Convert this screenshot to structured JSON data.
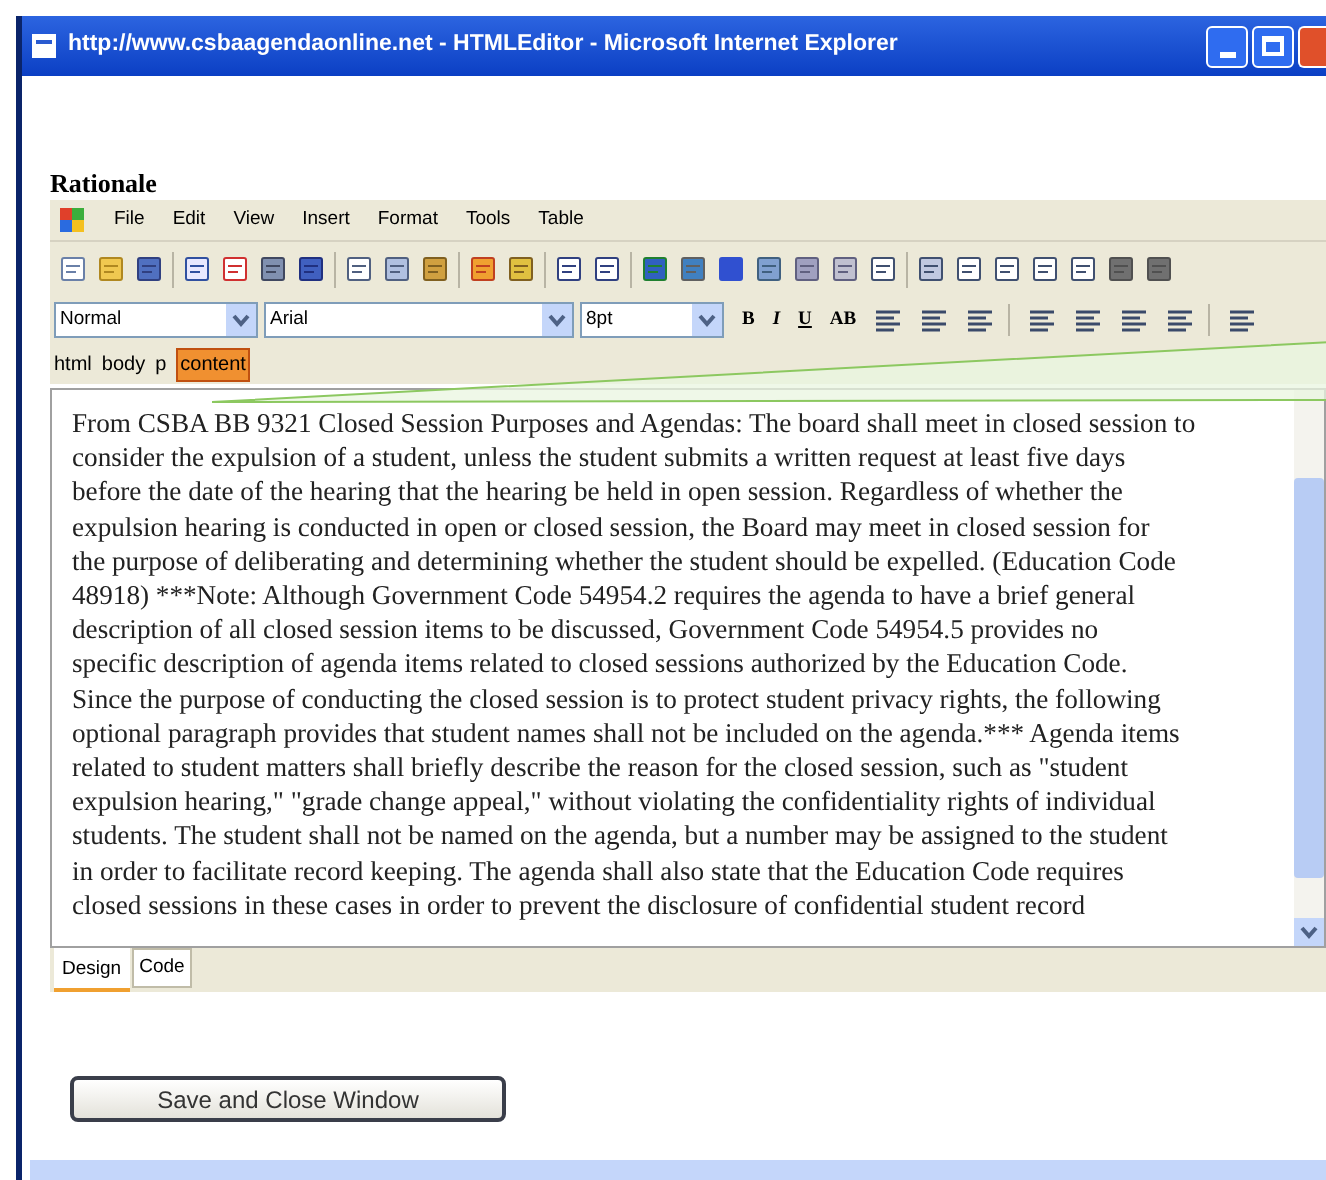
{
  "window": {
    "title": "http://www.csbaagendaonline.net - HTMLEditor - Microsoft Internet Explorer"
  },
  "heading": "Rationale",
  "menu": [
    "File",
    "Edit",
    "View",
    "Insert",
    "Format",
    "Tools",
    "Table"
  ],
  "format_bar": {
    "style": "Normal",
    "font": "Arial",
    "size": "8pt",
    "buttons": [
      "B",
      "I",
      "U",
      "AB"
    ]
  },
  "tag_path": [
    {
      "label": "html",
      "selected": false
    },
    {
      "label": "body",
      "selected": false
    },
    {
      "label": "p",
      "selected": false
    },
    {
      "label": "content",
      "selected": true
    }
  ],
  "editor": {
    "text": "From CSBA BB 9321 Closed Session Purposes and Agendas: The board shall meet in closed session to\nconsider the expulsion of a student, unless the student submits a written request at least five days\nbefore the date of the hearing that the hearing be held in open session. Regardless of whether the\nexpulsion hearing is conducted in open or closed session, the Board may meet in closed session for\nthe purpose of deliberating and determining whether the student should be expelled. (Education Code\n48918) ***Note: Although Government Code 54954.2 requires the agenda to have a brief general\ndescription of all closed session items to be discussed, Government Code 54954.5 provides no\nspecific description of agenda items related to closed sessions authorized by the Education Code.\nSince the purpose of conducting the closed session is to protect student privacy rights, the following\noptional paragraph provides that student names shall not be included on the agenda.*** Agenda items\nrelated to student matters shall briefly describe the reason for the closed session, such as \"student\nexpulsion hearing,\" \"grade change appeal,\" without violating the confidentiality rights of individual\nstudents. The student shall not be named on the agenda, but a number may be assigned to the student\nin order to facilitate record keeping. The agenda shall also state that the Education Code requires\nclosed sessions in these cases in order to prevent the disclosure of confidential student record"
  },
  "view_tabs": [
    {
      "label": "Design",
      "selected": true
    },
    {
      "label": "Code",
      "selected": false
    }
  ],
  "button": "Save and Close Window"
}
